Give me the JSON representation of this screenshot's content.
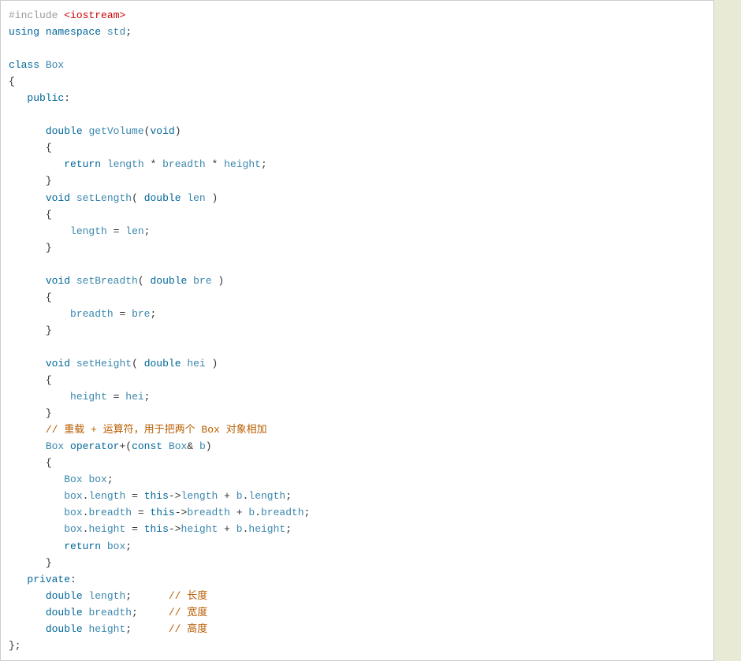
{
  "code": {
    "lines": [
      [
        {
          "c": "preproc",
          "t": "#include "
        },
        {
          "c": "angle",
          "t": "<iostream>"
        }
      ],
      [
        {
          "c": "kw",
          "t": "using"
        },
        {
          "c": "",
          "t": " "
        },
        {
          "c": "kw",
          "t": "namespace"
        },
        {
          "c": "",
          "t": " "
        },
        {
          "c": "ident",
          "t": "std"
        },
        {
          "c": "punc",
          "t": ";"
        }
      ],
      [
        {
          "c": "",
          "t": ""
        }
      ],
      [
        {
          "c": "kw",
          "t": "class"
        },
        {
          "c": "",
          "t": " "
        },
        {
          "c": "ident",
          "t": "Box"
        }
      ],
      [
        {
          "c": "punc",
          "t": "{"
        }
      ],
      [
        {
          "c": "",
          "t": "   "
        },
        {
          "c": "kw",
          "t": "public"
        },
        {
          "c": "punc",
          "t": ":"
        }
      ],
      [
        {
          "c": "",
          "t": ""
        }
      ],
      [
        {
          "c": "",
          "t": "      "
        },
        {
          "c": "kw",
          "t": "double"
        },
        {
          "c": "",
          "t": " "
        },
        {
          "c": "ident",
          "t": "getVolume"
        },
        {
          "c": "punc",
          "t": "("
        },
        {
          "c": "kw",
          "t": "void"
        },
        {
          "c": "punc",
          "t": ")"
        }
      ],
      [
        {
          "c": "",
          "t": "      "
        },
        {
          "c": "punc",
          "t": "{"
        }
      ],
      [
        {
          "c": "",
          "t": "         "
        },
        {
          "c": "kw",
          "t": "return"
        },
        {
          "c": "",
          "t": " "
        },
        {
          "c": "ident",
          "t": "length"
        },
        {
          "c": "",
          "t": " "
        },
        {
          "c": "op",
          "t": "*"
        },
        {
          "c": "",
          "t": " "
        },
        {
          "c": "ident",
          "t": "breadth"
        },
        {
          "c": "",
          "t": " "
        },
        {
          "c": "op",
          "t": "*"
        },
        {
          "c": "",
          "t": " "
        },
        {
          "c": "ident",
          "t": "height"
        },
        {
          "c": "punc",
          "t": ";"
        }
      ],
      [
        {
          "c": "",
          "t": "      "
        },
        {
          "c": "punc",
          "t": "}"
        }
      ],
      [
        {
          "c": "",
          "t": "      "
        },
        {
          "c": "kw",
          "t": "void"
        },
        {
          "c": "",
          "t": " "
        },
        {
          "c": "ident",
          "t": "setLength"
        },
        {
          "c": "punc",
          "t": "("
        },
        {
          "c": "",
          "t": " "
        },
        {
          "c": "kw",
          "t": "double"
        },
        {
          "c": "",
          "t": " "
        },
        {
          "c": "ident",
          "t": "len"
        },
        {
          "c": "",
          "t": " "
        },
        {
          "c": "punc",
          "t": ")"
        }
      ],
      [
        {
          "c": "",
          "t": "      "
        },
        {
          "c": "punc",
          "t": "{"
        }
      ],
      [
        {
          "c": "",
          "t": "          "
        },
        {
          "c": "ident",
          "t": "length"
        },
        {
          "c": "",
          "t": " "
        },
        {
          "c": "op",
          "t": "="
        },
        {
          "c": "",
          "t": " "
        },
        {
          "c": "ident",
          "t": "len"
        },
        {
          "c": "punc",
          "t": ";"
        }
      ],
      [
        {
          "c": "",
          "t": "      "
        },
        {
          "c": "punc",
          "t": "}"
        }
      ],
      [
        {
          "c": "",
          "t": ""
        }
      ],
      [
        {
          "c": "",
          "t": "      "
        },
        {
          "c": "kw",
          "t": "void"
        },
        {
          "c": "",
          "t": " "
        },
        {
          "c": "ident",
          "t": "setBreadth"
        },
        {
          "c": "punc",
          "t": "("
        },
        {
          "c": "",
          "t": " "
        },
        {
          "c": "kw",
          "t": "double"
        },
        {
          "c": "",
          "t": " "
        },
        {
          "c": "ident",
          "t": "bre"
        },
        {
          "c": "",
          "t": " "
        },
        {
          "c": "punc",
          "t": ")"
        }
      ],
      [
        {
          "c": "",
          "t": "      "
        },
        {
          "c": "punc",
          "t": "{"
        }
      ],
      [
        {
          "c": "",
          "t": "          "
        },
        {
          "c": "ident",
          "t": "breadth"
        },
        {
          "c": "",
          "t": " "
        },
        {
          "c": "op",
          "t": "="
        },
        {
          "c": "",
          "t": " "
        },
        {
          "c": "ident",
          "t": "bre"
        },
        {
          "c": "punc",
          "t": ";"
        }
      ],
      [
        {
          "c": "",
          "t": "      "
        },
        {
          "c": "punc",
          "t": "}"
        }
      ],
      [
        {
          "c": "",
          "t": ""
        }
      ],
      [
        {
          "c": "",
          "t": "      "
        },
        {
          "c": "kw",
          "t": "void"
        },
        {
          "c": "",
          "t": " "
        },
        {
          "c": "ident",
          "t": "setHeight"
        },
        {
          "c": "punc",
          "t": "("
        },
        {
          "c": "",
          "t": " "
        },
        {
          "c": "kw",
          "t": "double"
        },
        {
          "c": "",
          "t": " "
        },
        {
          "c": "ident",
          "t": "hei"
        },
        {
          "c": "",
          "t": " "
        },
        {
          "c": "punc",
          "t": ")"
        }
      ],
      [
        {
          "c": "",
          "t": "      "
        },
        {
          "c": "punc",
          "t": "{"
        }
      ],
      [
        {
          "c": "",
          "t": "          "
        },
        {
          "c": "ident",
          "t": "height"
        },
        {
          "c": "",
          "t": " "
        },
        {
          "c": "op",
          "t": "="
        },
        {
          "c": "",
          "t": " "
        },
        {
          "c": "ident",
          "t": "hei"
        },
        {
          "c": "punc",
          "t": ";"
        }
      ],
      [
        {
          "c": "",
          "t": "      "
        },
        {
          "c": "punc",
          "t": "}"
        }
      ],
      [
        {
          "c": "",
          "t": "      "
        },
        {
          "c": "cmt",
          "t": "// 重载 + 运算符，用于把两个 Box 对象相加"
        }
      ],
      [
        {
          "c": "",
          "t": "      "
        },
        {
          "c": "ident",
          "t": "Box"
        },
        {
          "c": "",
          "t": " "
        },
        {
          "c": "kw",
          "t": "operator"
        },
        {
          "c": "op",
          "t": "+"
        },
        {
          "c": "punc",
          "t": "("
        },
        {
          "c": "kw",
          "t": "const"
        },
        {
          "c": "",
          "t": " "
        },
        {
          "c": "ident",
          "t": "Box"
        },
        {
          "c": "op",
          "t": "&"
        },
        {
          "c": "",
          "t": " "
        },
        {
          "c": "ident",
          "t": "b"
        },
        {
          "c": "punc",
          "t": ")"
        }
      ],
      [
        {
          "c": "",
          "t": "      "
        },
        {
          "c": "punc",
          "t": "{"
        }
      ],
      [
        {
          "c": "",
          "t": "         "
        },
        {
          "c": "ident",
          "t": "Box"
        },
        {
          "c": "",
          "t": " "
        },
        {
          "c": "ident",
          "t": "box"
        },
        {
          "c": "punc",
          "t": ";"
        }
      ],
      [
        {
          "c": "",
          "t": "         "
        },
        {
          "c": "ident",
          "t": "box"
        },
        {
          "c": "punc",
          "t": "."
        },
        {
          "c": "ident",
          "t": "length"
        },
        {
          "c": "",
          "t": " "
        },
        {
          "c": "op",
          "t": "="
        },
        {
          "c": "",
          "t": " "
        },
        {
          "c": "kw",
          "t": "this"
        },
        {
          "c": "op",
          "t": "->"
        },
        {
          "c": "ident",
          "t": "length"
        },
        {
          "c": "",
          "t": " "
        },
        {
          "c": "op",
          "t": "+"
        },
        {
          "c": "",
          "t": " "
        },
        {
          "c": "ident",
          "t": "b"
        },
        {
          "c": "punc",
          "t": "."
        },
        {
          "c": "ident",
          "t": "length"
        },
        {
          "c": "punc",
          "t": ";"
        }
      ],
      [
        {
          "c": "",
          "t": "         "
        },
        {
          "c": "ident",
          "t": "box"
        },
        {
          "c": "punc",
          "t": "."
        },
        {
          "c": "ident",
          "t": "breadth"
        },
        {
          "c": "",
          "t": " "
        },
        {
          "c": "op",
          "t": "="
        },
        {
          "c": "",
          "t": " "
        },
        {
          "c": "kw",
          "t": "this"
        },
        {
          "c": "op",
          "t": "->"
        },
        {
          "c": "ident",
          "t": "breadth"
        },
        {
          "c": "",
          "t": " "
        },
        {
          "c": "op",
          "t": "+"
        },
        {
          "c": "",
          "t": " "
        },
        {
          "c": "ident",
          "t": "b"
        },
        {
          "c": "punc",
          "t": "."
        },
        {
          "c": "ident",
          "t": "breadth"
        },
        {
          "c": "punc",
          "t": ";"
        }
      ],
      [
        {
          "c": "",
          "t": "         "
        },
        {
          "c": "ident",
          "t": "box"
        },
        {
          "c": "punc",
          "t": "."
        },
        {
          "c": "ident",
          "t": "height"
        },
        {
          "c": "",
          "t": " "
        },
        {
          "c": "op",
          "t": "="
        },
        {
          "c": "",
          "t": " "
        },
        {
          "c": "kw",
          "t": "this"
        },
        {
          "c": "op",
          "t": "->"
        },
        {
          "c": "ident",
          "t": "height"
        },
        {
          "c": "",
          "t": " "
        },
        {
          "c": "op",
          "t": "+"
        },
        {
          "c": "",
          "t": " "
        },
        {
          "c": "ident",
          "t": "b"
        },
        {
          "c": "punc",
          "t": "."
        },
        {
          "c": "ident",
          "t": "height"
        },
        {
          "c": "punc",
          "t": ";"
        }
      ],
      [
        {
          "c": "",
          "t": "         "
        },
        {
          "c": "kw",
          "t": "return"
        },
        {
          "c": "",
          "t": " "
        },
        {
          "c": "ident",
          "t": "box"
        },
        {
          "c": "punc",
          "t": ";"
        }
      ],
      [
        {
          "c": "",
          "t": "      "
        },
        {
          "c": "punc",
          "t": "}"
        }
      ],
      [
        {
          "c": "",
          "t": "   "
        },
        {
          "c": "kw",
          "t": "private"
        },
        {
          "c": "punc",
          "t": ":"
        }
      ],
      [
        {
          "c": "",
          "t": "      "
        },
        {
          "c": "kw",
          "t": "double"
        },
        {
          "c": "",
          "t": " "
        },
        {
          "c": "ident",
          "t": "length"
        },
        {
          "c": "punc",
          "t": ";"
        },
        {
          "c": "",
          "t": "      "
        },
        {
          "c": "cmt",
          "t": "// 长度"
        }
      ],
      [
        {
          "c": "",
          "t": "      "
        },
        {
          "c": "kw",
          "t": "double"
        },
        {
          "c": "",
          "t": " "
        },
        {
          "c": "ident",
          "t": "breadth"
        },
        {
          "c": "punc",
          "t": ";"
        },
        {
          "c": "",
          "t": "     "
        },
        {
          "c": "cmt",
          "t": "// 宽度"
        }
      ],
      [
        {
          "c": "",
          "t": "      "
        },
        {
          "c": "kw",
          "t": "double"
        },
        {
          "c": "",
          "t": " "
        },
        {
          "c": "ident",
          "t": "height"
        },
        {
          "c": "punc",
          "t": ";"
        },
        {
          "c": "",
          "t": "      "
        },
        {
          "c": "cmt",
          "t": "// 高度"
        }
      ],
      [
        {
          "c": "punc",
          "t": "};"
        }
      ]
    ]
  }
}
